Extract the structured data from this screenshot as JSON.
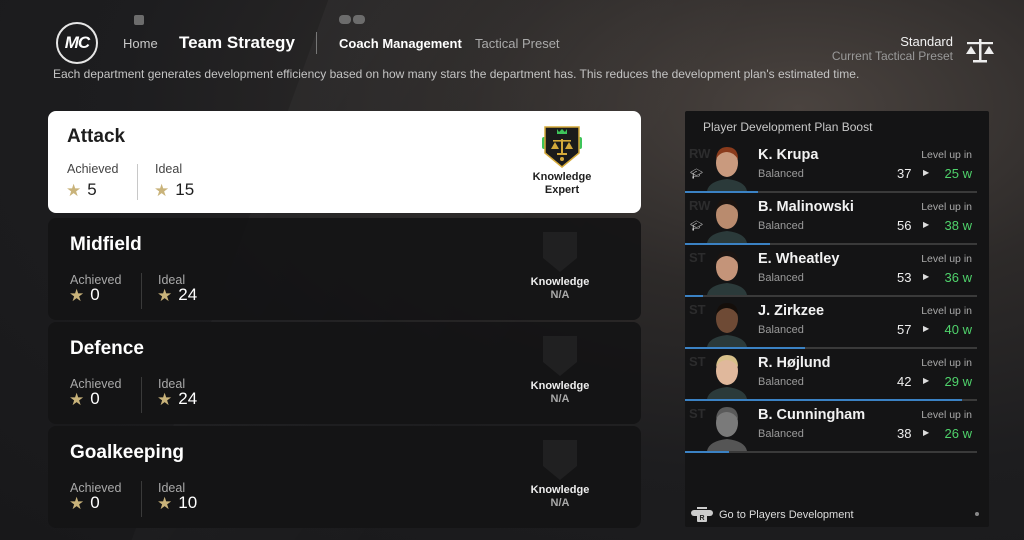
{
  "header": {
    "logo_text": "MC",
    "hint_lt": "LT",
    "hint_lb": "LB",
    "hint_rb": "RB",
    "nav_home": "Home",
    "nav_team_strategy": "Team Strategy",
    "subnav_coach_management": "Coach Management",
    "subnav_tactical_preset": "Tactical Preset",
    "preset_name": "Standard",
    "preset_label": "Current Tactical Preset",
    "preset_icon": "scale-icon"
  },
  "description": "Each department generates development efficiency based on how many stars the department has. This reduces the development plan's estimated time.",
  "departments": [
    {
      "name": "Attack",
      "achieved_label": "Achieved",
      "achieved": "5",
      "ideal_label": "Ideal",
      "ideal": "15",
      "badge_name": "Knowledge",
      "badge_level": "Expert",
      "selected": true
    },
    {
      "name": "Midfield",
      "achieved_label": "Achieved",
      "achieved": "0",
      "ideal_label": "Ideal",
      "ideal": "24",
      "badge_name": "Knowledge",
      "badge_level": "N/A",
      "selected": false
    },
    {
      "name": "Defence",
      "achieved_label": "Achieved",
      "achieved": "0",
      "ideal_label": "Ideal",
      "ideal": "24",
      "badge_name": "Knowledge",
      "badge_level": "N/A",
      "selected": false
    },
    {
      "name": "Goalkeeping",
      "achieved_label": "Achieved",
      "achieved": "0",
      "ideal_label": "Ideal",
      "ideal": "10",
      "badge_name": "Knowledge",
      "badge_level": "N/A",
      "selected": false
    }
  ],
  "panel": {
    "title": "Player Development Plan Boost",
    "level_up_label": "Level up in",
    "players": [
      {
        "position": "RW",
        "name": "K. Krupa",
        "style": "Balanced",
        "current": "37",
        "weeks": "25 w",
        "progress": 0.25,
        "boosted": true
      },
      {
        "position": "RW",
        "name": "B. Malinowski",
        "style": "Balanced",
        "current": "56",
        "weeks": "38 w",
        "progress": 0.29,
        "boosted": true
      },
      {
        "position": "ST",
        "name": "E. Wheatley",
        "style": "Balanced",
        "current": "53",
        "weeks": "36 w",
        "progress": 0.06,
        "boosted": false
      },
      {
        "position": "ST",
        "name": "J. Zirkzee",
        "style": "Balanced",
        "current": "57",
        "weeks": "40 w",
        "progress": 0.41,
        "boosted": false
      },
      {
        "position": "ST",
        "name": "R. Højlund",
        "style": "Balanced",
        "current": "42",
        "weeks": "29 w",
        "progress": 0.95,
        "boosted": false
      },
      {
        "position": "ST",
        "name": "B. Cunningham",
        "style": "Balanced",
        "current": "38",
        "weeks": "26 w",
        "progress": 0.15,
        "boosted": false
      }
    ],
    "footer_button_hint": "R",
    "footer_link": "Go to Players Development"
  },
  "colors": {
    "star": "#c9b37a",
    "weeks_green": "#4fd26b",
    "progress_blue": "#3b82c4",
    "badge_gold": "#d4a93a",
    "badge_green": "#3ec45a"
  }
}
